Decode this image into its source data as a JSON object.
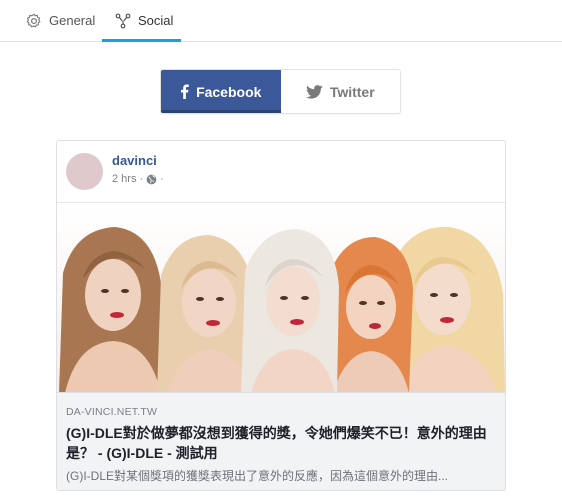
{
  "tabs": [
    {
      "label": "General",
      "icon": "gear-icon"
    },
    {
      "label": "Social",
      "icon": "share-nodes-icon",
      "active": true
    }
  ],
  "colors": {
    "accent": "#1e9fd6",
    "facebook": "#3b5998",
    "author": "#365899"
  },
  "toggle": {
    "facebook_label": "Facebook",
    "twitter_label": "Twitter",
    "selected": "Facebook"
  },
  "post": {
    "author": "davinci",
    "time": "2 hrs",
    "privacy_icon": "globe-icon",
    "trailing": "·",
    "link": {
      "domain": "DA-VINCI.NET.TW",
      "title": "(G)I-DLE對於做夢都沒想到獲得的獎，令她們爆笑不已！意外的理由是？ - (G)I-DLE - 測試用",
      "description": "(G)I-DLE對某個獎項的獲獎表現出了意外的反應，因為這個意外的理由..."
    }
  }
}
